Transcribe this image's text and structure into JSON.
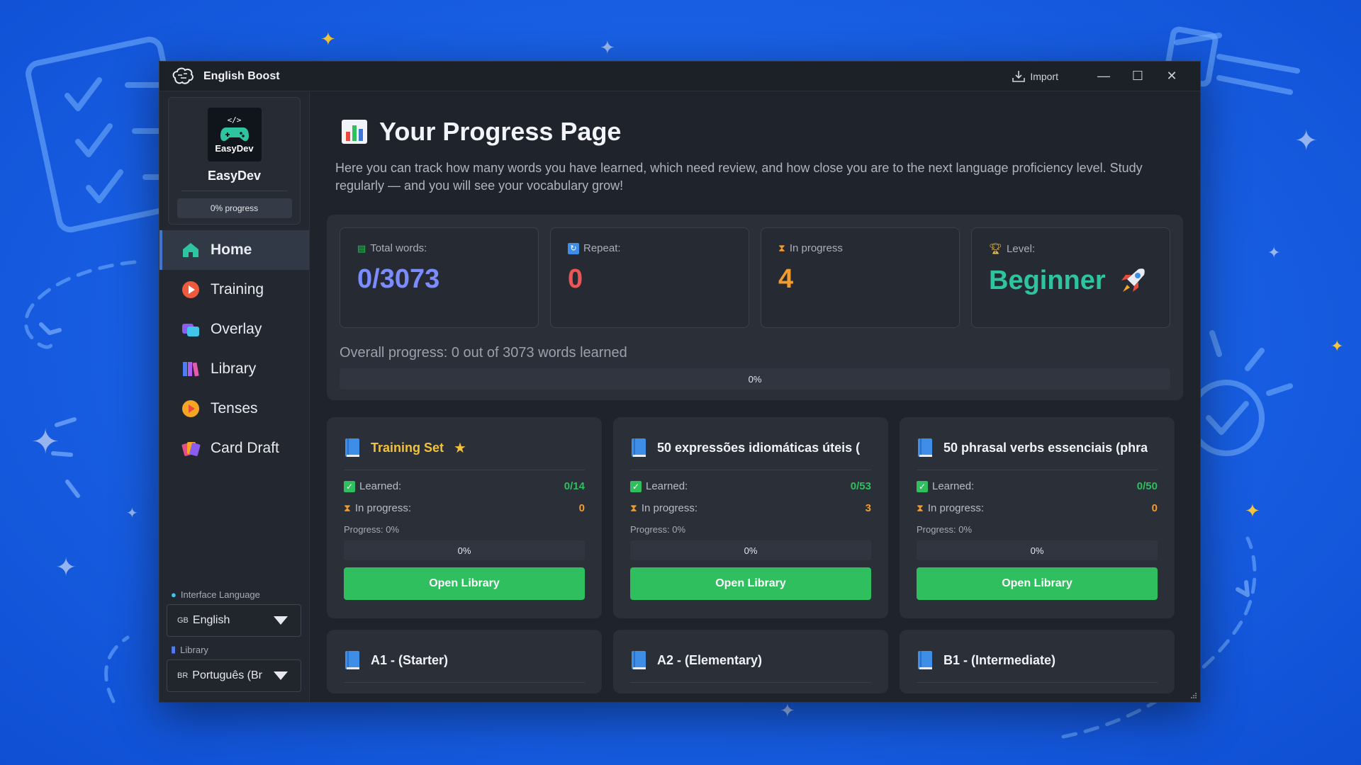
{
  "window": {
    "title": "English Boost",
    "import_label": "Import"
  },
  "colors": {
    "accent": "#3e76d6",
    "green": "#2fbf5f",
    "orange": "#f39b2f",
    "red": "#f05454",
    "teal": "#2ec4a0",
    "indigo": "#7a8cff",
    "gold": "#f3c23c"
  },
  "profile": {
    "avatar_code": "</>",
    "avatar_brand": "EasyDev",
    "name": "EasyDev",
    "progress": "0% progress"
  },
  "nav": [
    {
      "label": "Home",
      "icon": "home-icon",
      "active": true
    },
    {
      "label": "Training",
      "icon": "training-icon"
    },
    {
      "label": "Overlay",
      "icon": "overlay-icon"
    },
    {
      "label": "Library",
      "icon": "library-icon"
    },
    {
      "label": "Tenses",
      "icon": "tenses-icon"
    },
    {
      "label": "Card Draft",
      "icon": "card-draft-icon"
    }
  ],
  "settings": {
    "interface_language_label": "Interface Language",
    "interface_language_flag": "GB",
    "interface_language_value": "English",
    "library_label": "Library",
    "library_flag": "BR",
    "library_value": "Português (Br"
  },
  "page": {
    "title": "Your Progress Page",
    "description": "Here you can track how many words you have learned, which need review, and how close you are to the next language proficiency level. Study regularly — and you will see your vocabulary grow!"
  },
  "stats": {
    "total_words_label": "Total words:",
    "total_words_value": "0/3073",
    "repeat_label": "Repeat:",
    "repeat_value": "0",
    "in_progress_label": "In progress",
    "in_progress_value": "4",
    "level_label": "Level:",
    "level_value": "Beginner",
    "overall_text": "Overall progress: 0 out of 3073 words learned",
    "overall_percent_label": "0%",
    "overall_fraction": 0
  },
  "libraries": [
    {
      "title": "Training Set",
      "featured": true,
      "star": "★",
      "learned_label": "Learned:",
      "learned": "0/14",
      "in_progress_label": "In progress:",
      "in_progress": "0",
      "progress_label": "Progress: 0%",
      "bar_label": "0%",
      "button": "Open Library"
    },
    {
      "title": "50 expressões idiomáticas úteis (",
      "learned_label": "Learned:",
      "learned": "0/53",
      "in_progress_label": "In progress:",
      "in_progress": "3",
      "progress_label": "Progress: 0%",
      "bar_label": "0%",
      "button": "Open Library"
    },
    {
      "title": "50 phrasal verbs essenciais (phra",
      "learned_label": "Learned:",
      "learned": "0/50",
      "in_progress_label": "In progress:",
      "in_progress": "0",
      "progress_label": "Progress: 0%",
      "bar_label": "0%",
      "button": "Open Library"
    }
  ],
  "more_libraries": [
    {
      "title": "A1 - (Starter)"
    },
    {
      "title": "A2 - (Elementary)"
    },
    {
      "title": "B1 - (Intermediate)"
    }
  ]
}
